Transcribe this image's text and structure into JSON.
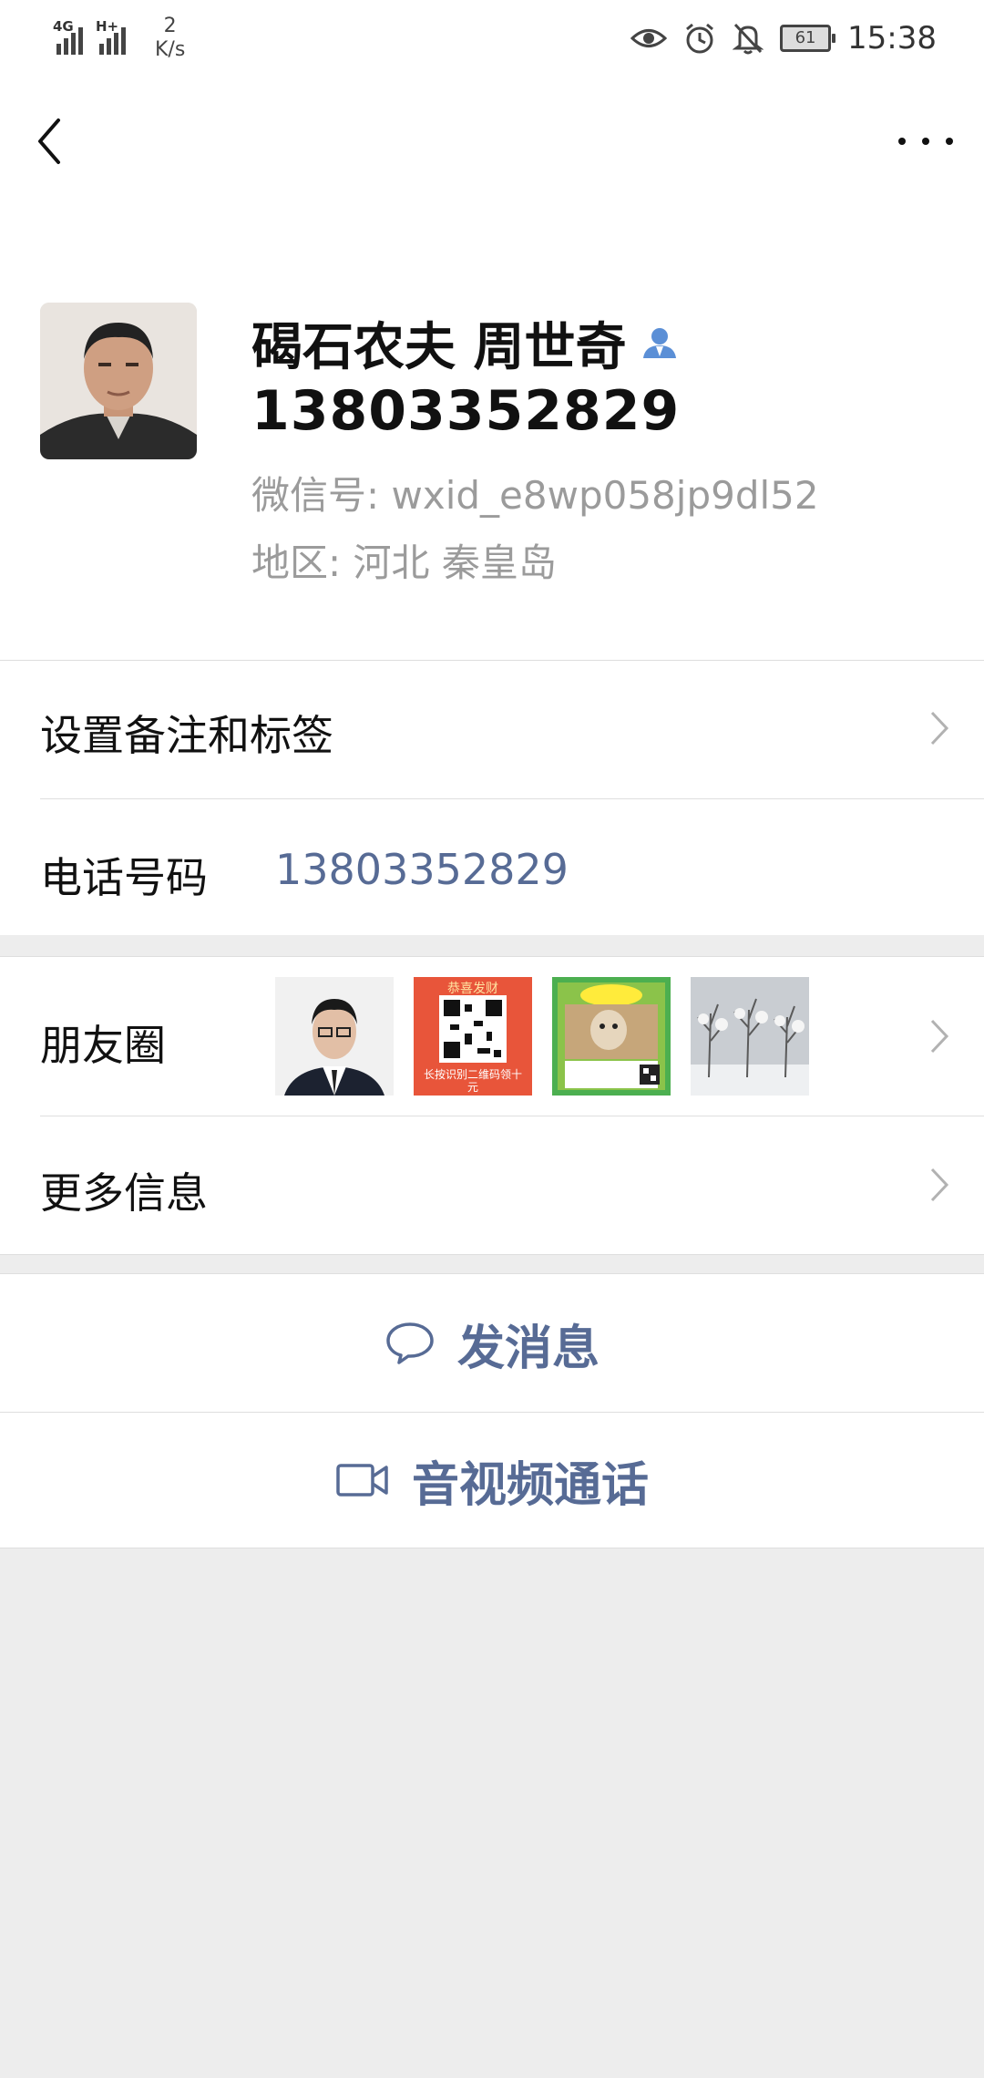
{
  "status_bar": {
    "network_1": "4G",
    "network_2": "H+",
    "speed_value": "2",
    "speed_unit": "K/s",
    "battery": "61",
    "time": "15:38"
  },
  "profile": {
    "name": "碣石农夫 周世奇",
    "phone": "13803352829",
    "wechat_id": "微信号:  wxid_e8wp058jp9dl52",
    "region": "地区:  河北  秦皇岛"
  },
  "rows": {
    "remark_label": "设置备注和标签",
    "phone_label": "电话号码",
    "phone_value": "13803352829",
    "moments_label": "朋友圈",
    "more_info_label": "更多信息"
  },
  "moments_thumbs": {
    "qr_top": "恭喜发财",
    "qr_bottom": "长按识别二维码领十元"
  },
  "actions": {
    "message_label": "发消息",
    "call_label": "音视频通话"
  },
  "colors": {
    "link_blue": "#576b95",
    "background": "#ededed",
    "secondary_text": "#9b9b9b"
  }
}
